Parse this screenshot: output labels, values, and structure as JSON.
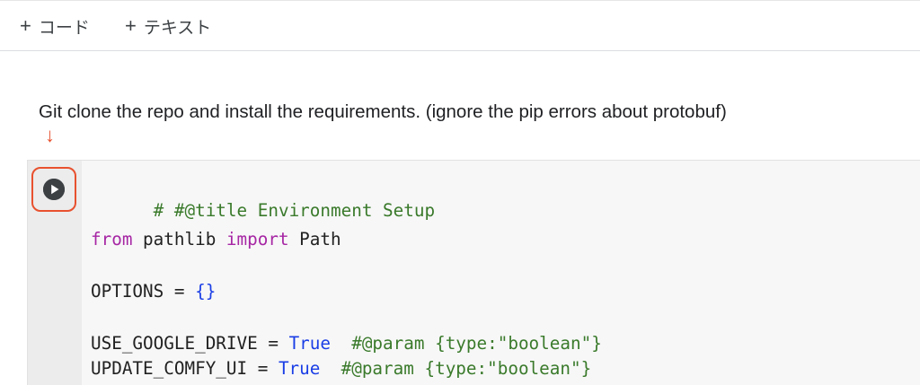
{
  "toolbar": {
    "add_code_label": "コード",
    "add_text_label": "テキスト"
  },
  "markdown": {
    "text": "Git clone the repo and install the requirements. (ignore the pip errors about protobuf)"
  },
  "annotation": {
    "arrow": "↓",
    "color": "#e8512f"
  },
  "code_cell": {
    "line1_comment": "# #@title Environment Setup",
    "line2_from": "from",
    "line2_module": " pathlib ",
    "line2_import": "import",
    "line2_name": " Path",
    "line3_var": "OPTIONS = ",
    "line3_braces": "{}",
    "line4_var": "USE_GOOGLE_DRIVE = ",
    "line4_value": "True",
    "line4_comment": "  #@param {type:\"boolean\"}",
    "line5_var": "UPDATE_COMFY_UI = ",
    "line5_value": "True",
    "line5_comment": "  #@param {type:\"boolean\"}"
  },
  "colors": {
    "comment": "#3a7a2b",
    "keyword": "#a626a4",
    "constant": "#1a3ee6",
    "run_button": "#3c4043"
  }
}
